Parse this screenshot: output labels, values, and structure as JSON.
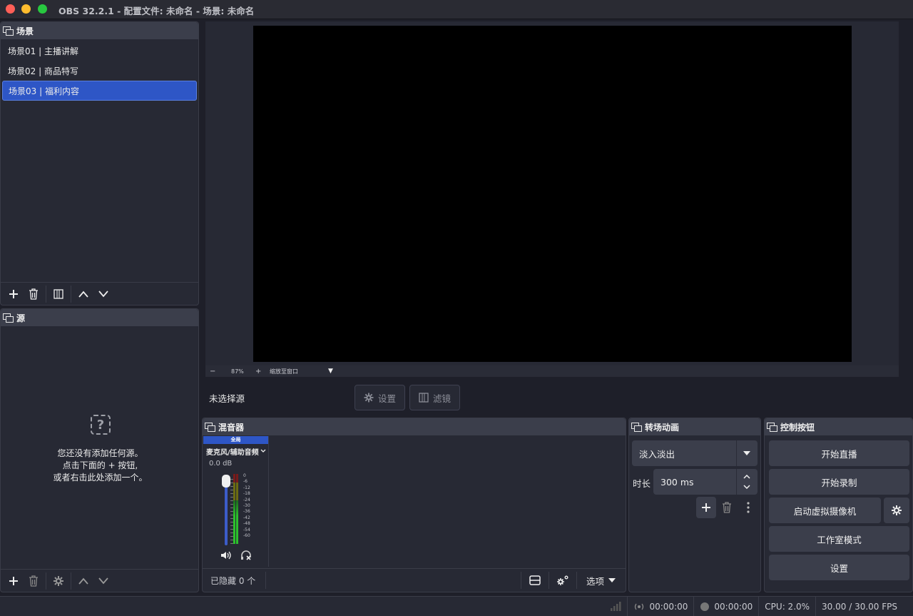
{
  "window": {
    "title": "OBS 32.2.1 - 配置文件: 未命名 - 场景: 未命名"
  },
  "scenes": {
    "title": "场景",
    "items": [
      {
        "label": "场景01 | 主播讲解",
        "selected": false
      },
      {
        "label": "场景02 | 商品特写",
        "selected": false
      },
      {
        "label": "场景03 | 福利内容",
        "selected": true
      }
    ]
  },
  "sources": {
    "title": "源",
    "empty_line1": "您还没有添加任何源。",
    "empty_line2": "点击下面的 + 按钮,",
    "empty_line3": "或者右击此处添加一个。"
  },
  "preview": {
    "zoom_minus": "−",
    "zoom_level": "87%",
    "zoom_plus": "+",
    "zoom_mode": "缩放至窗口"
  },
  "source_bar": {
    "no_source": "未选择源",
    "settings_label": "设置",
    "filters_label": "滤镜"
  },
  "mixer": {
    "title": "混音器",
    "global_badge": "全局",
    "channel_name": "麦克风/辅助音频",
    "volume_db": "0.0 dB",
    "scale": [
      "0",
      "-6",
      "-12",
      "-18",
      "-24",
      "-30",
      "-36",
      "-42",
      "-48",
      "-54",
      "-60"
    ],
    "hidden_count": "已隐藏 0 个",
    "options_label": "选项"
  },
  "transitions": {
    "title": "转场动画",
    "selected": "淡入淡出",
    "duration_label": "时长",
    "duration_value": "300 ms"
  },
  "controls": {
    "title": "控制按钮",
    "start_stream": "开始直播",
    "start_record": "开始录制",
    "start_virtualcam": "启动虚拟摄像机",
    "studio_mode": "工作室模式",
    "settings": "设置"
  },
  "status_bar": {
    "stream_time": "00:00:00",
    "record_time": "00:00:00",
    "cpu": "CPU: 2.0%",
    "fps": "30.00 / 30.00 FPS"
  },
  "colors": {
    "accent": "#2e56c6",
    "background": "#1e1f29",
    "panel": "#272934",
    "button": "#3b3e4b"
  }
}
